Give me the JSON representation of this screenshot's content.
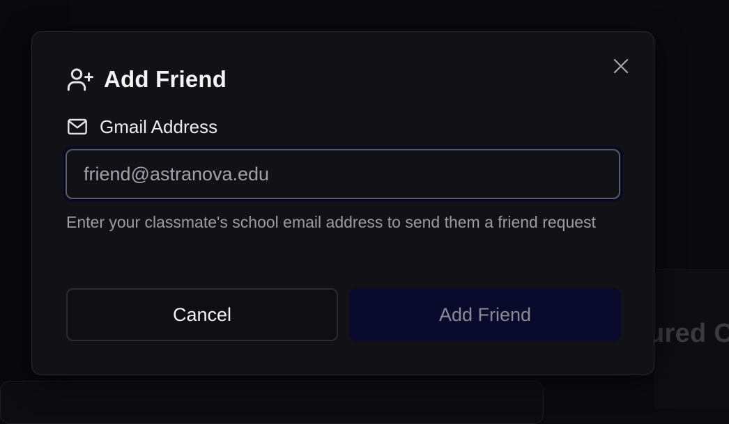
{
  "background": {
    "card_title_fragment": "ured C"
  },
  "modal": {
    "title": "Add Friend",
    "title_icon": "user-plus-icon",
    "close_icon": "close-icon",
    "field": {
      "icon": "mail-icon",
      "label": "Gmail Address",
      "placeholder": "friend@astranova.edu",
      "value": ""
    },
    "helper_text": "Enter your classmate's school email address to send them a friend request",
    "buttons": {
      "cancel_label": "Cancel",
      "submit_label": "Add Friend"
    }
  },
  "colors": {
    "modal_background": "#121216",
    "modal_border": "#2a2a30",
    "focus_ring": "#080a24",
    "primary_disabled": "#0a0b2c",
    "text_primary": "#f4f4f5",
    "text_muted": "#9c9ca6"
  }
}
